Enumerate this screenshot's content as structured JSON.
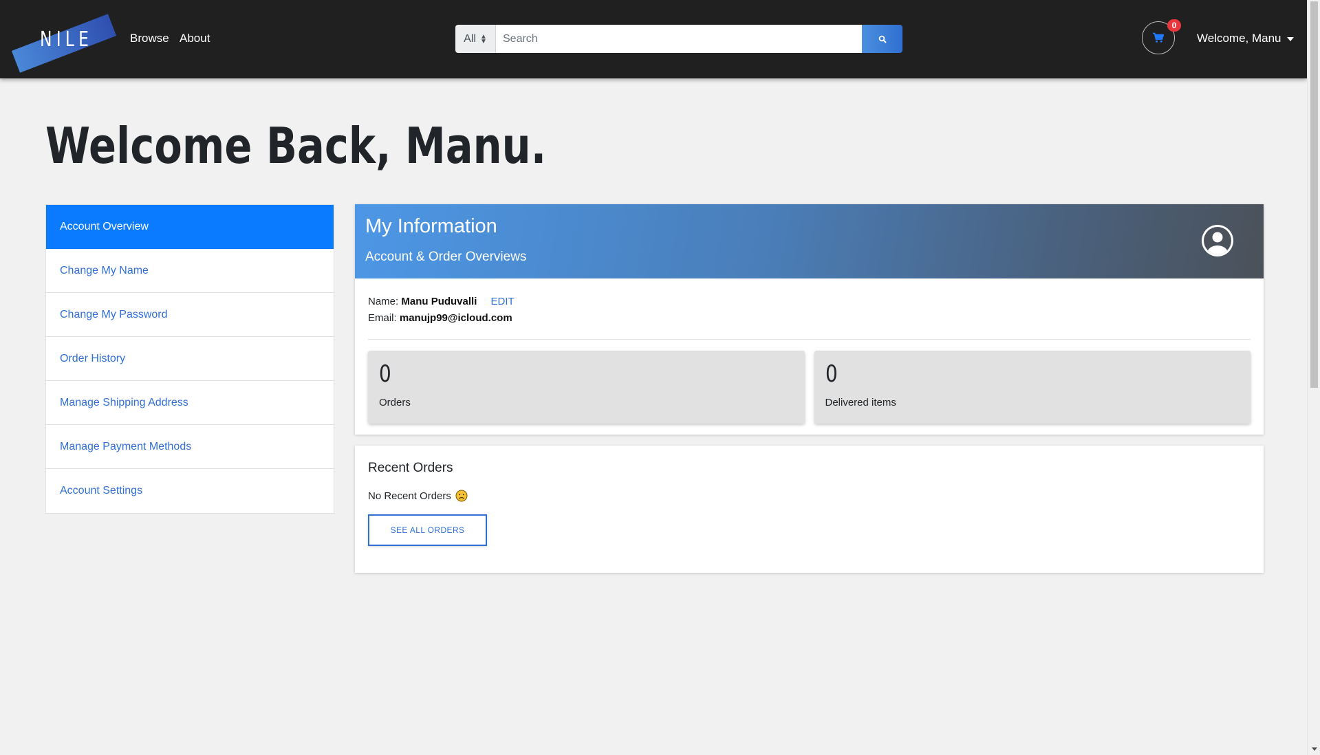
{
  "nav": {
    "brand": "NILE",
    "links": [
      {
        "label": "Browse"
      },
      {
        "label": "About"
      }
    ],
    "search": {
      "category": "All",
      "placeholder": "Search",
      "value": ""
    },
    "cart_count": "0",
    "user_menu_label": "Welcome, Manu"
  },
  "page": {
    "title": "Welcome Back, Manu."
  },
  "sidebar": {
    "items": [
      {
        "label": "Account Overview",
        "active": true
      },
      {
        "label": "Change My Name"
      },
      {
        "label": "Change My Password"
      },
      {
        "label": "Order History"
      },
      {
        "label": "Manage Shipping Address"
      },
      {
        "label": "Manage Payment Methods"
      },
      {
        "label": "Account Settings"
      }
    ]
  },
  "info": {
    "title": "My Information",
    "subtitle": "Account & Order Overviews",
    "name_label": "Name:",
    "name_value": "Manu Puduvalli",
    "edit_label": "EDIT",
    "email_label": "Email:",
    "email_value": "manujp99@icloud.com",
    "stats": [
      {
        "value": "0",
        "label": "Orders"
      },
      {
        "value": "0",
        "label": "Delivered items"
      }
    ]
  },
  "recent_orders": {
    "title": "Recent Orders",
    "empty_text": "No Recent Orders",
    "empty_icon": "sad-face-icon",
    "button_label": "SEE ALL ORDERS"
  },
  "colors": {
    "navbar": "#202020",
    "accent_blue": "#0a7bff",
    "link_blue": "#2f6fd6",
    "badge_red": "#e8383d",
    "page_bg": "#f1f1f1"
  }
}
